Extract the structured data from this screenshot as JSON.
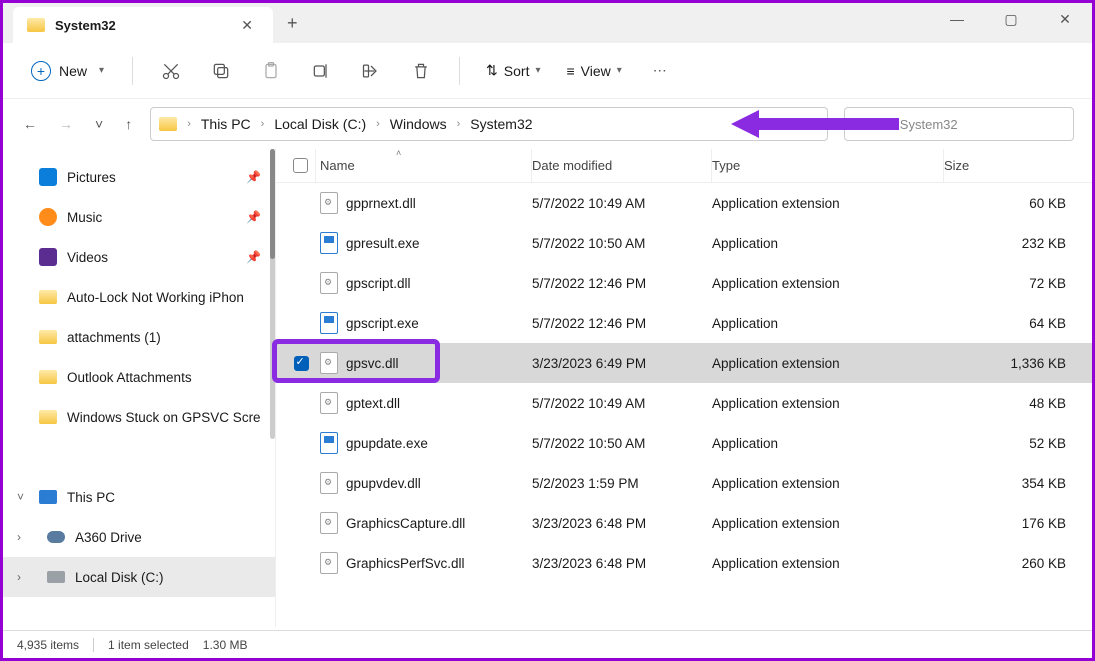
{
  "tab": {
    "title": "System32"
  },
  "toolbar": {
    "new_label": "New",
    "sort_label": "Sort",
    "view_label": "View"
  },
  "breadcrumb": {
    "parts": [
      "This PC",
      "Local Disk (C:)",
      "Windows",
      "System32"
    ]
  },
  "search": {
    "placeholder": "Search System32"
  },
  "sidebar": {
    "items": [
      {
        "label": "Pictures",
        "pinned": true,
        "icon": "pictures"
      },
      {
        "label": "Music",
        "pinned": true,
        "icon": "music"
      },
      {
        "label": "Videos",
        "pinned": true,
        "icon": "videos"
      },
      {
        "label": "Auto-Lock Not Working iPhon",
        "icon": "folder"
      },
      {
        "label": "attachments (1)",
        "icon": "folder"
      },
      {
        "label": "Outlook Attachments",
        "icon": "folder"
      },
      {
        "label": "Windows Stuck on GPSVC Scre",
        "icon": "folder"
      }
    ],
    "group2": [
      {
        "label": "This PC",
        "icon": "pc",
        "expander": "˅"
      },
      {
        "label": "A360 Drive",
        "icon": "a360",
        "expander": "›",
        "indent": 1
      },
      {
        "label": "Local Disk (C:)",
        "icon": "drive",
        "expander": "›",
        "indent": 1,
        "selected": true
      }
    ]
  },
  "columns": {
    "name": "Name",
    "date": "Date modified",
    "type": "Type",
    "size": "Size"
  },
  "files": [
    {
      "name": "gpprnext.dll",
      "date": "5/7/2022 10:49 AM",
      "type": "Application extension",
      "size": "60 KB",
      "icon": "dll"
    },
    {
      "name": "gpresult.exe",
      "date": "5/7/2022 10:50 AM",
      "type": "Application",
      "size": "232 KB",
      "icon": "exe"
    },
    {
      "name": "gpscript.dll",
      "date": "5/7/2022 12:46 PM",
      "type": "Application extension",
      "size": "72 KB",
      "icon": "dll"
    },
    {
      "name": "gpscript.exe",
      "date": "5/7/2022 12:46 PM",
      "type": "Application",
      "size": "64 KB",
      "icon": "exe"
    },
    {
      "name": "gpsvc.dll",
      "date": "3/23/2023 6:49 PM",
      "type": "Application extension",
      "size": "1,336 KB",
      "icon": "dll",
      "selected": true,
      "highlighted": true
    },
    {
      "name": "gptext.dll",
      "date": "5/7/2022 10:49 AM",
      "type": "Application extension",
      "size": "48 KB",
      "icon": "dll"
    },
    {
      "name": "gpupdate.exe",
      "date": "5/7/2022 10:50 AM",
      "type": "Application",
      "size": "52 KB",
      "icon": "exe"
    },
    {
      "name": "gpupvdev.dll",
      "date": "5/2/2023 1:59 PM",
      "type": "Application extension",
      "size": "354 KB",
      "icon": "dll"
    },
    {
      "name": "GraphicsCapture.dll",
      "date": "3/23/2023 6:48 PM",
      "type": "Application extension",
      "size": "176 KB",
      "icon": "dll"
    },
    {
      "name": "GraphicsPerfSvc.dll",
      "date": "3/23/2023 6:48 PM",
      "type": "Application extension",
      "size": "260 KB",
      "icon": "dll"
    }
  ],
  "status": {
    "total": "4,935 items",
    "selected": "1 item selected",
    "size": "1.30 MB"
  }
}
